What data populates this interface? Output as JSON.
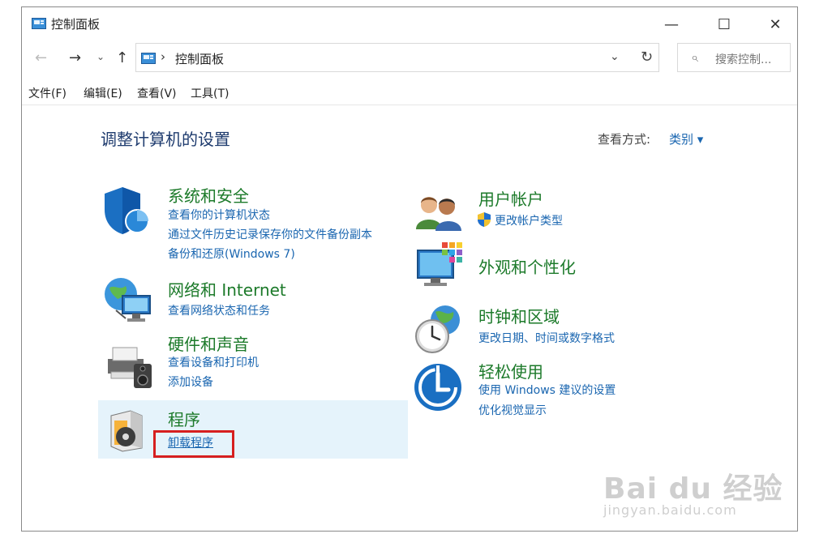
{
  "window": {
    "title": "控制面板",
    "minimize": "—",
    "maximize": "☐",
    "close": "✕",
    "icon": "control-panel-icon"
  },
  "address_bar": {
    "back": "←",
    "forward": "→",
    "history": "⌄",
    "up": "↑",
    "separator": "›",
    "path": "控制面板",
    "dropdown": "⌄",
    "refresh": "↻",
    "search_icon": "⌕",
    "search_placeholder": "搜索控制..."
  },
  "menu": {
    "file": "文件(F)",
    "edit": "编辑(E)",
    "view": "查看(V)",
    "tools": "工具(T)"
  },
  "main": {
    "heading": "调整计算机的设置",
    "view_by_label": "查看方式:",
    "view_by_value": "类别 ▾"
  },
  "categories": {
    "security": {
      "title": "系统和安全",
      "links": [
        "查看你的计算机状态",
        "通过文件历史记录保存你的文件备份副本",
        "备份和还原(Windows 7)"
      ],
      "icon": "shield-icon"
    },
    "network": {
      "title": "网络和 Internet",
      "links": [
        "查看网络状态和任务"
      ],
      "icon": "network-globe-icon"
    },
    "hardware": {
      "title": "硬件和声音",
      "links": [
        "查看设备和打印机",
        "添加设备"
      ],
      "icon": "printer-speaker-icon"
    },
    "programs": {
      "title": "程序",
      "links": [
        "卸载程序"
      ],
      "icon": "programs-disc-icon"
    },
    "user": {
      "title": "用户帐户",
      "links": [
        "更改帐户类型"
      ],
      "icon": "users-icon",
      "link_icon": "uac-shield-icon"
    },
    "appearance": {
      "title": "外观和个性化",
      "icon": "monitor-palette-icon"
    },
    "clock": {
      "title": "时钟和区域",
      "links": [
        "更改日期、时间或数字格式"
      ],
      "icon": "clock-globe-icon"
    },
    "ease": {
      "title": "轻松使用",
      "links": [
        "使用 Windows 建议的设置",
        "优化视觉显示"
      ],
      "icon": "ease-of-access-icon"
    }
  },
  "watermark": {
    "logo": "Bai du 经验",
    "url": "jingyan.baidu.com"
  },
  "colors": {
    "category_title": "#1c7a2a",
    "link": "#1a66b0",
    "heading": "#1e3b6e",
    "highlight_row": "#e5f3fb",
    "annotation_red": "#d61f1f"
  }
}
